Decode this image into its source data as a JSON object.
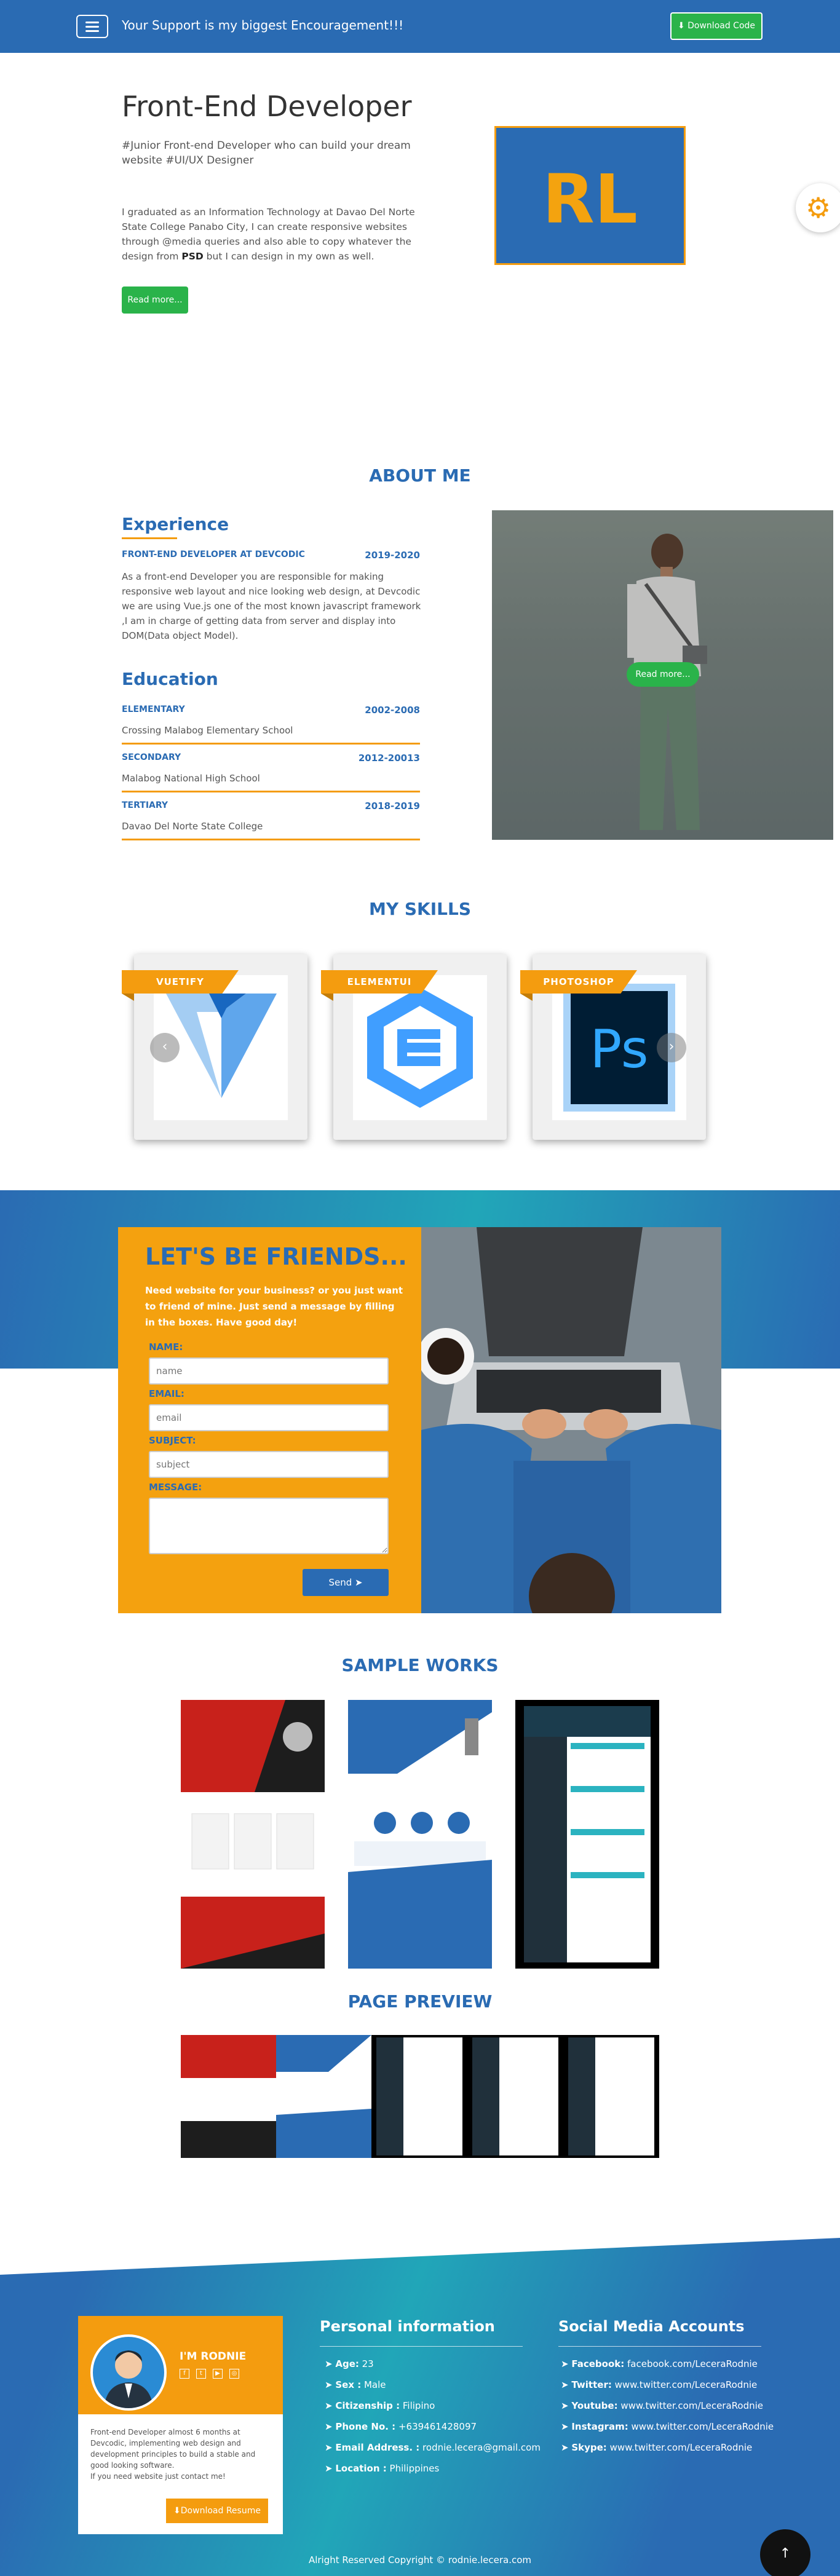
{
  "nav": {
    "title": "Your Support is my biggest Encouragement!!!",
    "download_label": "Download Code"
  },
  "hero": {
    "title": "Front-End Developer",
    "tagline": "#Junior Front-end Developer who can build your dream website #UI/UX Designer",
    "description_before": "I graduated as an Information Technology at Davao Del Norte State College Panabo City, I can create responsive websites through @media queries and also able to copy whatever the design from ",
    "description_bold": "PSD",
    "description_after": " but I can design in my own as well.",
    "read_more": "Read more...",
    "logo_text": "RL"
  },
  "about": {
    "title": "ABOUT ME",
    "experience": {
      "heading": "Experience",
      "role": "FRONT-END DEVELOPER AT DEVCODIC",
      "date": "2019-2020",
      "text": "As a front-end Developer you are responsible for making responsive web layout and nice looking web design, at Devcodic we are using Vue.js one of the most known javascript framework ,I am in charge of getting data from server and display into DOM(Data object Model)."
    },
    "education": {
      "heading": "Education",
      "items": [
        {
          "level": "ELEMENTARY",
          "date": "2002-2008",
          "school": "Crossing Malabog Elementary School"
        },
        {
          "level": "SECONDARY",
          "date": "2012-20013",
          "school": "Malabog National High School"
        },
        {
          "level": "TERTIARY",
          "date": "2018-2019",
          "school": "Davao Del Norte State College"
        }
      ]
    },
    "photo_read_more": "Read more..."
  },
  "skills": {
    "title": "MY SKILLS",
    "cards": [
      {
        "name": "VUETIFY"
      },
      {
        "name": "ELEMENTUI"
      },
      {
        "name": "PHOTOSHOP",
        "logo_text": "Ps"
      }
    ]
  },
  "friends": {
    "title": "LET'S BE FRIENDS...",
    "description": "Need website for your business? or you just want to friend of mine. Just send a message by filling in the boxes. Have good day!",
    "name_label": "NAME:",
    "name_placeholder": "name",
    "email_label": "EMAIL:",
    "email_placeholder": "email",
    "subject_label": "SUBJECT:",
    "subject_placeholder": "subject",
    "message_label": "MESSAGE:",
    "send_label": "Send"
  },
  "works": {
    "title": "SAMPLE WORKS",
    "preview_title": "PAGE PREVIEW"
  },
  "footer": {
    "name": "I'M RODNIE",
    "description": "Front-end Developer almost 6 months at Devcodic, implementing web design and development principles to build a stable and good looking software.\nIf you need website just contact me!",
    "download_resume": "Download Resume",
    "personal_heading": "Personal information",
    "personal": [
      {
        "label": "Age:",
        "value": " 23"
      },
      {
        "label": "Sex :",
        "value": " Male"
      },
      {
        "label": "Citizenship :",
        "value": " Filipino"
      },
      {
        "label": "Phone No. :",
        "value": " +639461428097"
      },
      {
        "label": "Email Address. :",
        "value": " rodnie.lecera@gmail.com"
      },
      {
        "label": "Location :",
        "value": " Philippines"
      }
    ],
    "social_heading": "Social Media Accounts",
    "social": [
      {
        "label": "Facebook:",
        "value": " facebook.com/LeceraRodnie"
      },
      {
        "label": "Twitter:",
        "value": " www.twitter.com/LeceraRodnie"
      },
      {
        "label": "Youtube:",
        "value": " www.twitter.com/LeceraRodnie"
      },
      {
        "label": "Instagram:",
        "value": " www.twitter.com/LeceraRodnie"
      },
      {
        "label": "Skype:",
        "value": " www.twitter.com/LeceraRodnie"
      }
    ],
    "copyright": "Alright Reserved Copyright © rodnie.lecera.com"
  },
  "colors": {
    "primary_blue": "#2a6bb3",
    "accent_orange": "#f49c0f",
    "button_green": "#2ab34a"
  }
}
